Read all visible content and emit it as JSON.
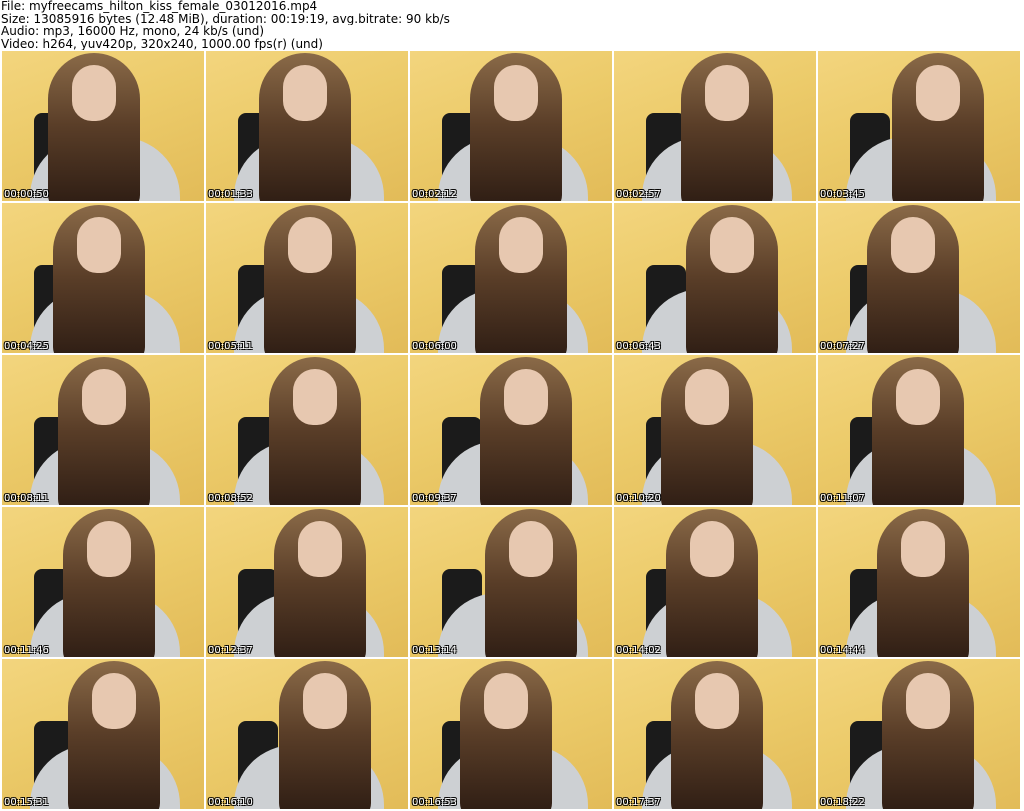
{
  "header": {
    "file_line": "File: myfreecams_hilton_kiss_female_03012016.mp4",
    "size_line": "Size: 13085916 bytes (12.48 MiB), duration: 00:19:19, avg.bitrate: 90 kb/s",
    "audio_line": "Audio: mp3, 16000 Hz, mono, 24 kb/s (und)",
    "video_line": "Video: h264, yuv420p, 320x240, 1000.00 fps(r) (und)"
  },
  "thumbnails": [
    {
      "timestamp": "00:00:50"
    },
    {
      "timestamp": "00:01:33"
    },
    {
      "timestamp": "00:02:12"
    },
    {
      "timestamp": "00:02:57"
    },
    {
      "timestamp": "00:03:45"
    },
    {
      "timestamp": "00:04:25"
    },
    {
      "timestamp": "00:05:11"
    },
    {
      "timestamp": "00:06:00"
    },
    {
      "timestamp": "00:06:43"
    },
    {
      "timestamp": "00:07:27"
    },
    {
      "timestamp": "00:08:11"
    },
    {
      "timestamp": "00:08:52"
    },
    {
      "timestamp": "00:09:37"
    },
    {
      "timestamp": "00:10:20"
    },
    {
      "timestamp": "00:11:07"
    },
    {
      "timestamp": "00:11:46"
    },
    {
      "timestamp": "00:12:37"
    },
    {
      "timestamp": "00:13:14"
    },
    {
      "timestamp": "00:14:02"
    },
    {
      "timestamp": "00:14:44"
    },
    {
      "timestamp": "00:15:31"
    },
    {
      "timestamp": "00:16:10"
    },
    {
      "timestamp": "00:16:53"
    },
    {
      "timestamp": "00:17:37"
    },
    {
      "timestamp": "00:18:22"
    }
  ]
}
